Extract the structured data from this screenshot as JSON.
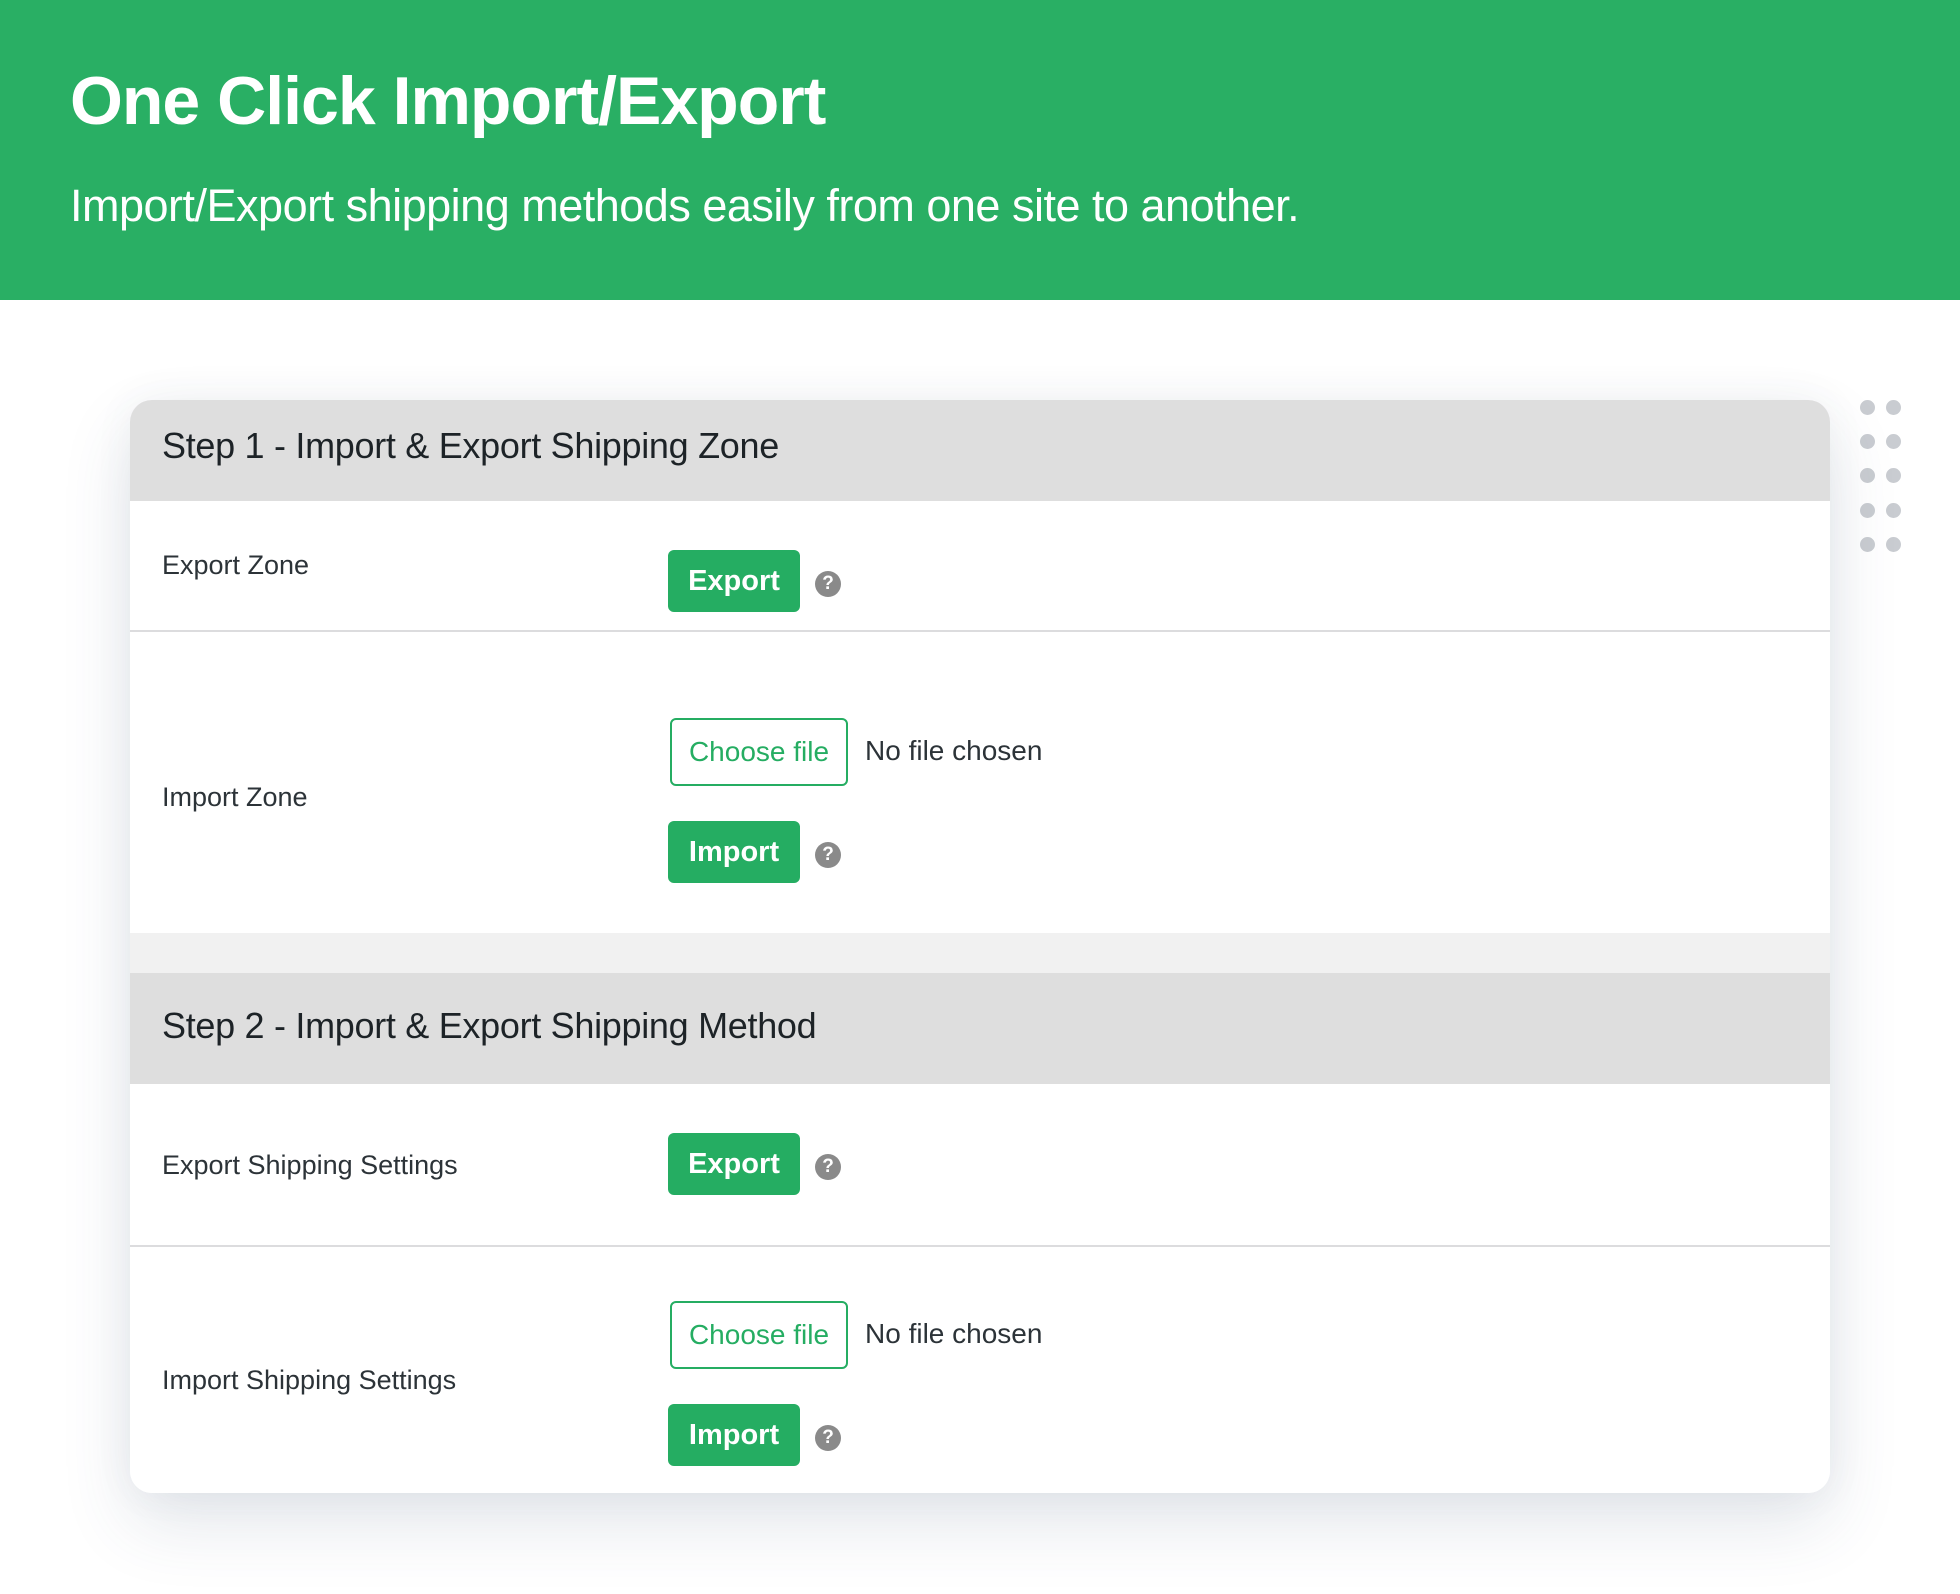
{
  "header": {
    "title": "One Click Import/Export",
    "subtitle": "Import/Export shipping methods easily from one site to another."
  },
  "colors": {
    "brand_green": "#29af64",
    "button_green": "#25ad62",
    "section_header_bg": "#dedede",
    "help_icon": "#8a8a8a"
  },
  "steps": [
    {
      "title": "Step 1 - Import & Export Shipping Zone",
      "export_row": {
        "label": "Export Zone",
        "button_label": "Export",
        "help_icon": "question-circle-icon",
        "help_glyph": "?"
      },
      "import_row": {
        "label": "Import Zone",
        "file_button_label": "Choose file",
        "file_status": "No file chosen",
        "button_label": "Import",
        "help_icon": "question-circle-icon",
        "help_glyph": "?"
      }
    },
    {
      "title": "Step 2 - Import & Export Shipping Method",
      "export_row": {
        "label": "Export Shipping Settings",
        "button_label": "Export",
        "help_icon": "question-circle-icon",
        "help_glyph": "?"
      },
      "import_row": {
        "label": "Import Shipping Settings",
        "file_button_label": "Choose file",
        "file_status": "No file chosen",
        "button_label": "Import",
        "help_icon": "question-circle-icon",
        "help_glyph": "?"
      }
    }
  ]
}
